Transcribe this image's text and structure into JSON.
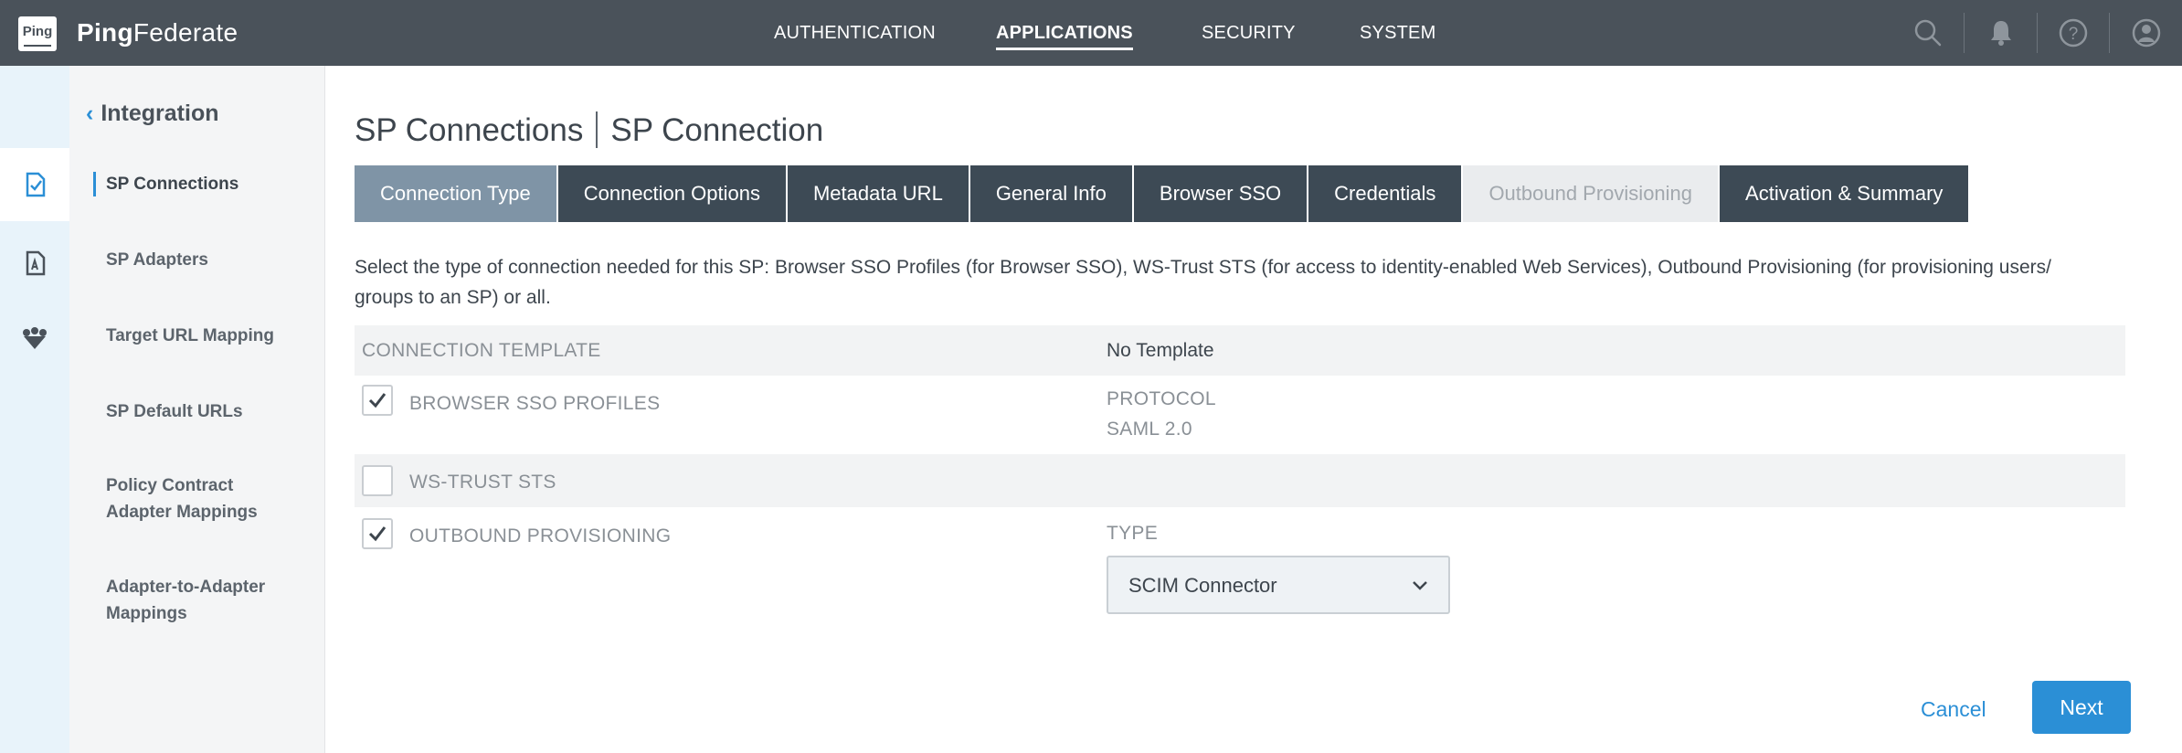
{
  "header": {
    "logo_text": "Ping",
    "brand_bold": "Ping",
    "brand_light": "Federate",
    "nav": [
      "AUTHENTICATION",
      "APPLICATIONS",
      "SECURITY",
      "SYSTEM"
    ],
    "active_nav": "APPLICATIONS",
    "icons": [
      "search-icon",
      "bell-icon",
      "help-icon",
      "user-icon"
    ]
  },
  "rail": {
    "icons": [
      "document-check-icon",
      "document-adapter-icon",
      "shield-network-icon"
    ],
    "active_index": 0
  },
  "sidebar": {
    "back_label": "Integration",
    "items": [
      {
        "label": "SP Connections",
        "active": true
      },
      {
        "label": "SP Adapters"
      },
      {
        "label": "Target URL Mapping"
      },
      {
        "label": "SP Default URLs"
      },
      {
        "label": "Policy Contract Adapter Mappings",
        "lines": [
          "Policy Contract",
          "Adapter Mappings"
        ]
      },
      {
        "label": "Adapter-to-Adapter Mappings",
        "lines": [
          "Adapter-to-Adapter",
          "Mappings"
        ]
      }
    ]
  },
  "page": {
    "title_part1": "SP Connections",
    "title_part2": "SP Connection",
    "tabs": [
      {
        "label": "Connection Type",
        "state": "active"
      },
      {
        "label": "Connection Options"
      },
      {
        "label": "Metadata URL"
      },
      {
        "label": "General Info"
      },
      {
        "label": "Browser SSO"
      },
      {
        "label": "Credentials"
      },
      {
        "label": "Outbound Provisioning",
        "state": "disabled"
      },
      {
        "label": "Activation & Summary"
      }
    ],
    "description_line1": "Select the type of connection needed for this SP: Browser SSO Profiles (for Browser SSO), WS-Trust STS (for access to identity-enabled Web Services), Outbound Provisioning (for provisioning users/",
    "description_line2": "groups to an SP) or all."
  },
  "form": {
    "connection_template_label": "CONNECTION TEMPLATE",
    "connection_template_value": "No Template",
    "browser_sso_label": "BROWSER SSO PROFILES",
    "browser_sso_checked": true,
    "protocol_label": "PROTOCOL",
    "protocol_value": "SAML 2.0",
    "ws_trust_label": "WS-TRUST STS",
    "ws_trust_checked": false,
    "outbound_label": "OUTBOUND PROVISIONING",
    "outbound_checked": true,
    "type_label": "TYPE",
    "type_value": "SCIM Connector"
  },
  "actions": {
    "cancel": "Cancel",
    "next": "Next"
  },
  "colors": {
    "header_bg": "#4a525a",
    "accent": "#2b8fd6",
    "tab_bg": "#3d4a55",
    "tab_active_bg": "#7f94a6"
  }
}
